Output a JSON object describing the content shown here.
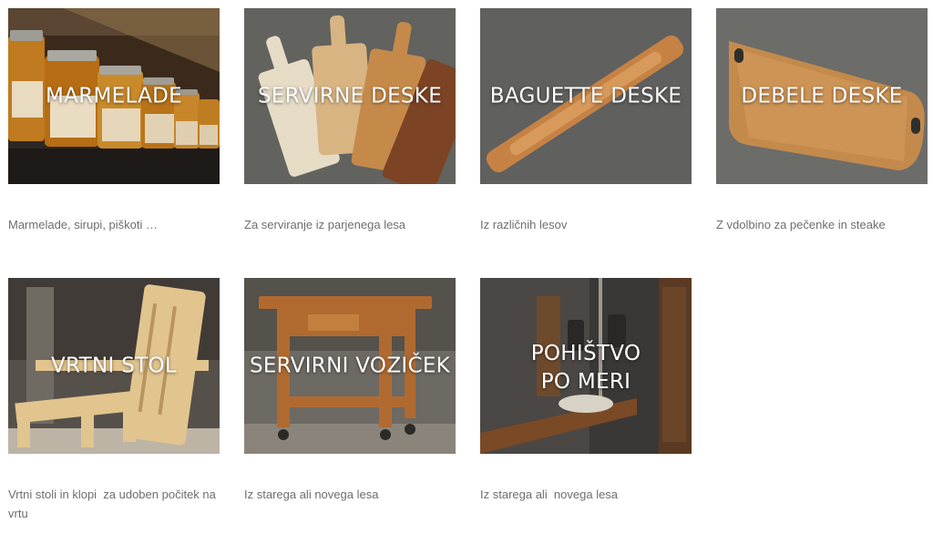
{
  "products": [
    {
      "title": "MARMELADE",
      "caption": "Marmelade, sirupi, piškoti …",
      "image": "jam-jars-on-shelf"
    },
    {
      "title": "SERVIRNE DESKE",
      "caption": "Za serviranje iz parjenega lesa",
      "image": "serving-boards"
    },
    {
      "title": "BAGUETTE DESKE",
      "caption": "Iz različnih lesov",
      "image": "baguette-board"
    },
    {
      "title": "DEBELE DESKE",
      "caption": "Z vdolbino za pečenke in steake",
      "image": "thick-board"
    },
    {
      "title": "VRTNI STOL",
      "caption": "Vrtni stoli in klopi  za udoben počitek na vrtu",
      "image": "garden-chair"
    },
    {
      "title": "SERVIRNI VOZIČEK",
      "caption": "Iz starega ali novega lesa",
      "image": "serving-cart"
    },
    {
      "title": "POHIŠTVO\nPO MERI",
      "caption": "Iz starega ali  novega lesa",
      "image": "custom-bathroom-furniture"
    }
  ]
}
